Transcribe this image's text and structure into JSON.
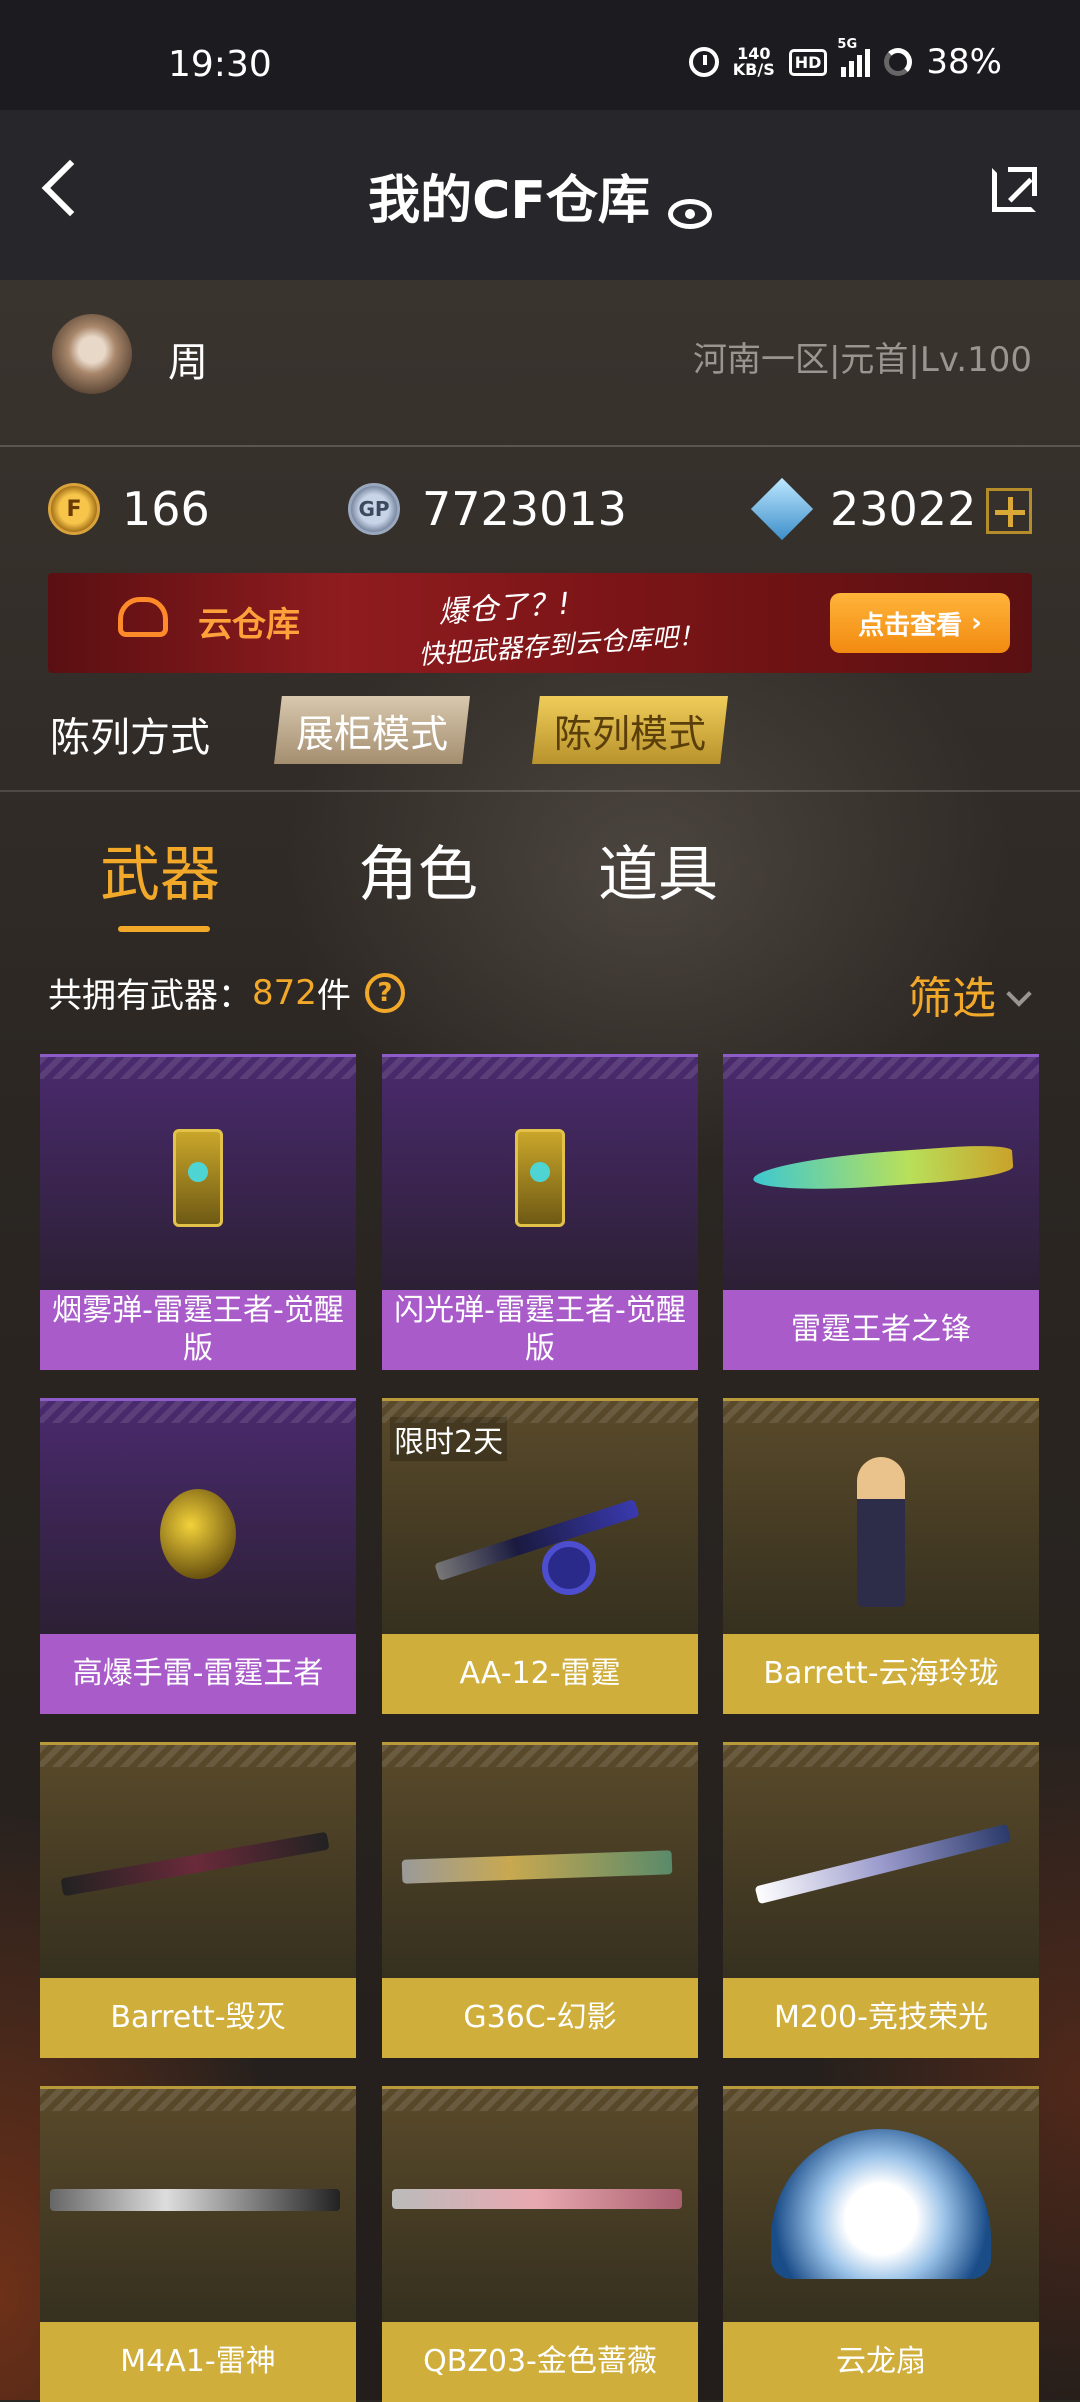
{
  "status_bar": {
    "time": "19:30",
    "net_speed_value": "140",
    "net_speed_unit": "KB/S",
    "hd": "HD",
    "network": "5G",
    "battery": "38%"
  },
  "header": {
    "title": "我的CF仓库"
  },
  "profile": {
    "name": "周",
    "server": "河南一区|元首|Lv.100"
  },
  "currency": {
    "cf_points": "166",
    "gp": "7723013",
    "gp_icon_text": "GP",
    "diamonds": "23022"
  },
  "banner": {
    "label": "云仓库",
    "tagline": "爆仓了？!",
    "subline": "快把武器存到云仓库吧！",
    "button": "点击查看"
  },
  "display_mode": {
    "label": "陈列方式",
    "options": [
      "展柜模式",
      "陈列模式"
    ],
    "selected": "陈列模式"
  },
  "tabs": [
    "武器",
    "角色",
    "道具"
  ],
  "active_tab": "武器",
  "weapon_count": {
    "prefix": "共拥有武器：",
    "count": "872",
    "suffix": "件",
    "help": "?"
  },
  "filter_label": "筛选",
  "items": [
    {
      "name": "烟雾弹-雷霆王者-觉醒版",
      "rarity": "purple",
      "icon": "smoke-grenade"
    },
    {
      "name": "闪光弹-雷霆王者-觉醒版",
      "rarity": "purple",
      "icon": "flash-grenade"
    },
    {
      "name": "雷霆王者之锋",
      "rarity": "purple",
      "icon": "knife"
    },
    {
      "name": "高爆手雷-雷霆王者",
      "rarity": "purple",
      "icon": "he-grenade"
    },
    {
      "name": "AA-12-雷霆",
      "rarity": "gold",
      "icon": "shotgun",
      "badge": "限时2天"
    },
    {
      "name": "Barrett-云海玲珑",
      "rarity": "gold",
      "icon": "character"
    },
    {
      "name": "Barrett-毁灭",
      "rarity": "gold",
      "icon": "sniper-rifle"
    },
    {
      "name": "G36C-幻影",
      "rarity": "gold",
      "icon": "assault-rifle"
    },
    {
      "name": "M200-竞技荣光",
      "rarity": "gold",
      "icon": "sniper-rifle"
    },
    {
      "name": "M4A1-雷神",
      "rarity": "gold",
      "icon": "assault-rifle"
    },
    {
      "name": "QBZ03-金色蔷薇",
      "rarity": "gold",
      "icon": "assault-rifle"
    },
    {
      "name": "云龙扇",
      "rarity": "gold",
      "icon": "fan"
    }
  ],
  "colors": {
    "accent": "#f2a92a",
    "purple_rarity": "#a85bc9",
    "gold_rarity": "#cfae3b"
  }
}
